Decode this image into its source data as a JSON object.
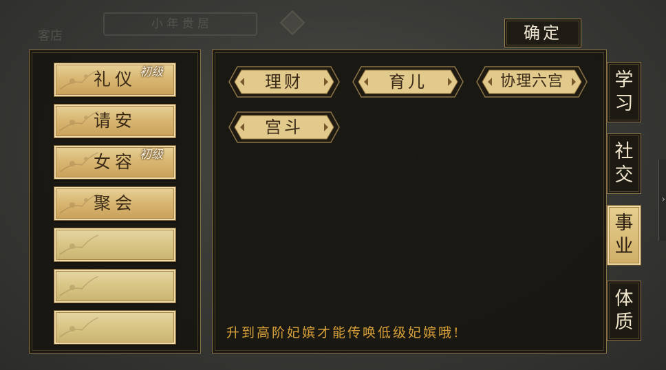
{
  "background": {
    "tab_text": "小 年 贵 居",
    "label_text": "客店"
  },
  "confirm_label": "确定",
  "skills": [
    {
      "name": "礼仪",
      "rank": "初级"
    },
    {
      "name": "请安",
      "rank": ""
    },
    {
      "name": "女容",
      "rank": "初级"
    },
    {
      "name": "聚会",
      "rank": ""
    },
    {
      "name": "",
      "rank": ""
    },
    {
      "name": "",
      "rank": ""
    },
    {
      "name": "",
      "rank": ""
    }
  ],
  "careers": [
    {
      "label": "理财"
    },
    {
      "label": "育儿"
    },
    {
      "label": "协理六宫"
    },
    {
      "label": "宫斗"
    }
  ],
  "hint": "升到高阶妃嫔才能传唤低级妃嫔哦!",
  "categories": [
    {
      "top": "学",
      "bottom": "习"
    },
    {
      "top": "社",
      "bottom": "交"
    },
    {
      "top": "事",
      "bottom": "业"
    },
    {
      "top": "体",
      "bottom": "质"
    }
  ],
  "active_category": "事业",
  "colors": {
    "gold_accent": "#d9a23a",
    "panel_border": "#8a7447",
    "tag_fill": "#e2c98c"
  },
  "icons": {
    "edge_arrow": "chevron-right-icon"
  }
}
